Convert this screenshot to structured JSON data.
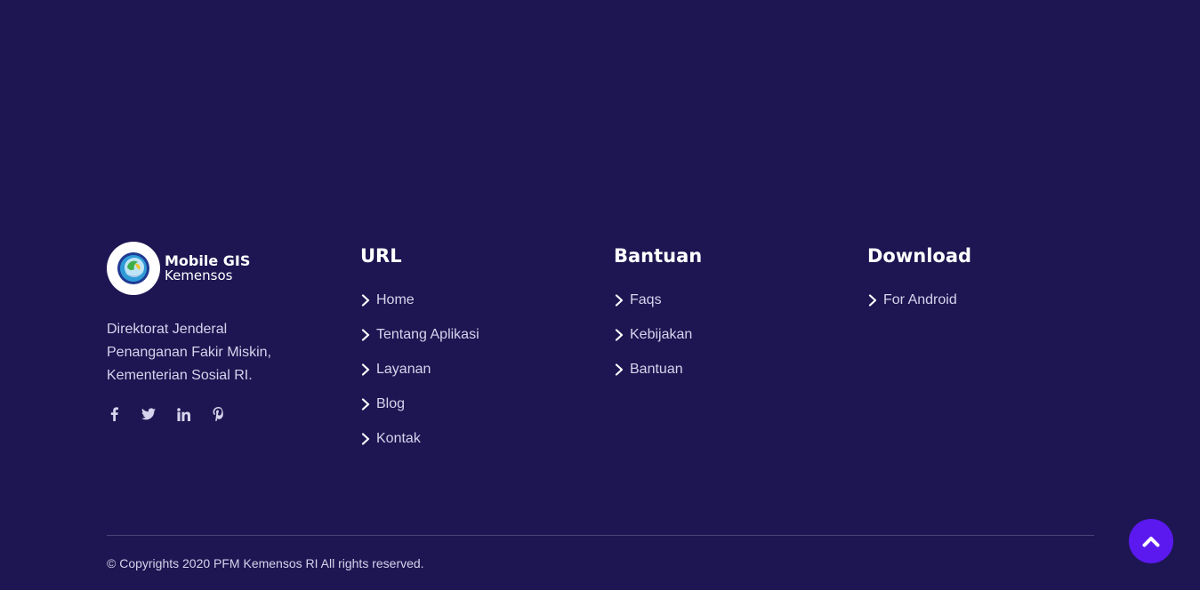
{
  "brand": {
    "title": "Mobile GIS",
    "subtitle": "Kemensos",
    "logo_icon": "kemensos-globe-logo",
    "description_lines": [
      "Direktorat Jenderal",
      "Penanganan Fakir Miskin,",
      "Kementerian Sosial RI."
    ],
    "socials": [
      {
        "name": "facebook",
        "icon": "facebook-icon"
      },
      {
        "name": "twitter",
        "icon": "twitter-icon"
      },
      {
        "name": "linkedin",
        "icon": "linkedin-icon"
      },
      {
        "name": "pinterest",
        "icon": "pinterest-icon"
      }
    ]
  },
  "columns": {
    "url": {
      "title": "URL",
      "links": [
        "Home",
        "Tentang Aplikasi",
        "Layanan",
        "Blog",
        "Kontak"
      ]
    },
    "bantuan": {
      "title": "Bantuan",
      "links": [
        "Faqs",
        "Kebijakan",
        "Bantuan"
      ]
    },
    "download": {
      "title": "Download",
      "links": [
        "For Android"
      ]
    }
  },
  "copyright": "© Copyrights 2020 PFM Kemensos RI All rights reserved.",
  "back_to_top": {
    "icon": "chevron-up-icon"
  },
  "colors": {
    "background": "#1d1652",
    "text_muted": "#d6d3ec",
    "accent": "#5b19f0",
    "divider": "#4a4478"
  }
}
